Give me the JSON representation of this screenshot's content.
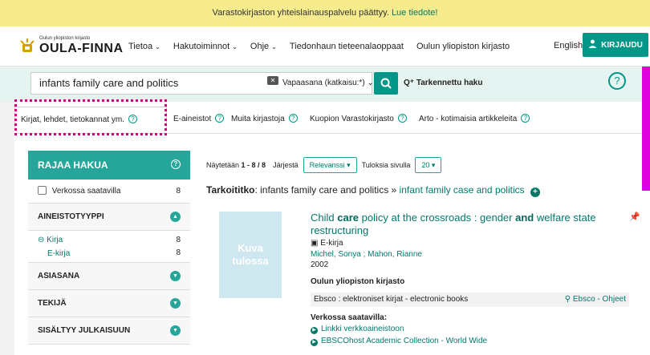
{
  "notice": {
    "text": "Varastokirjaston yhteislainauspalvelu päättyy.",
    "link": "Lue tiedote!"
  },
  "header": {
    "logo_small": "Oulun yliopiston kirjasto",
    "logo_big": "OULA-FINNA",
    "nav": [
      "Tietoa",
      "Hakutoiminnot",
      "Ohje",
      "Tiedonhaun tieteenalaoppaat",
      "Oulun yliopiston kirjasto"
    ],
    "language": "English",
    "login": "KIRJAUDU"
  },
  "search": {
    "query": "infants family care and politics",
    "type": "Vapaasana (katkaisu:*)",
    "advanced": "Tarkennettu haku",
    "help": "?"
  },
  "tabs": [
    "Kirjat, lehdet, tietokannat ym.",
    "E-aineistot",
    "Muita kirjastoja",
    "Kuopion Varastokirjasto",
    "Arto - kotimaisia artikkeleita"
  ],
  "sidebar": {
    "title": "RAJAA HAKUA",
    "online": {
      "label": "Verkossa saatavilla",
      "count": "8"
    },
    "facets": [
      {
        "label": "AINEISTOTYYPPI",
        "open": true
      },
      {
        "label": "ASIASANA",
        "open": false
      },
      {
        "label": "TEKIJÄ",
        "open": false
      },
      {
        "label": "SISÄLTYY JULKAISUUN",
        "open": false
      }
    ],
    "type_values": [
      {
        "label": "Kirja",
        "count": "8"
      },
      {
        "label": "E-kirja",
        "count": "8"
      }
    ]
  },
  "results": {
    "showing_prefix": "Näytetään",
    "showing_range": "1 - 8 / 8",
    "sort_label": "Järjestä",
    "sort_value": "Relevanssi",
    "per_page_label": "Tuloksia sivulla",
    "per_page_value": "20",
    "did_you_mean_label": "Tarkoititko",
    "did_you_mean_query": ": infants family care and politics »",
    "did_you_mean_suggestion": "infant family case and politics"
  },
  "record": {
    "thumb_text": "Kuva tulossa",
    "title_parts": [
      "Child ",
      "care",
      " policy at the crossroads : gender ",
      "and",
      " welfare state restructuring"
    ],
    "format": "E-kirja",
    "authors": "Michel, Sonya ; Mahon, Rianne",
    "year": "2002",
    "library": "Oulun yliopiston kirjasto",
    "source": "Ebsco : elektroniset kirjat - electronic books",
    "source_link": "Ebsco - Ohjeet",
    "availability": "Verkossa saatavilla:",
    "links": [
      "Linkki verkkoaineistoon",
      "EBSCOhost Academic Collection - World Wide"
    ]
  },
  "colors": {
    "accent": "#009688",
    "notice": "#f6ec8d",
    "highlight": "#d1007b"
  }
}
